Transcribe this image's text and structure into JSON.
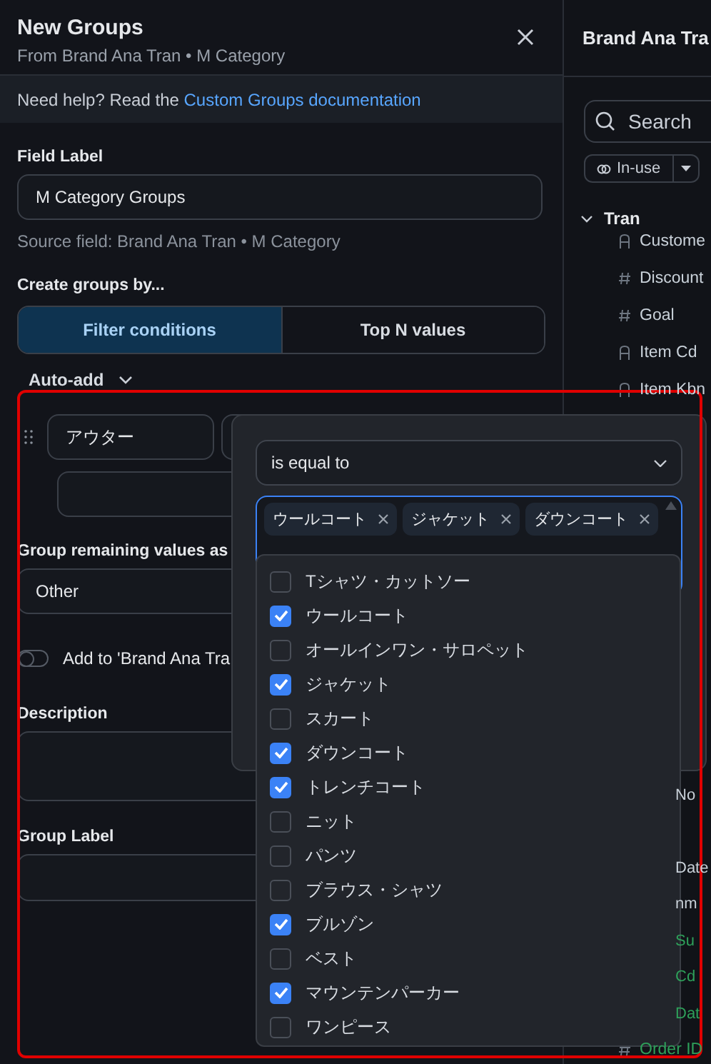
{
  "panel": {
    "title": "New Groups",
    "subtitle": "From Brand Ana Tran • M Category",
    "help": {
      "text": "Need help? Read the",
      "link": "Custom Groups documentation"
    },
    "field_label": {
      "label": "Field Label",
      "value": "M Category Groups",
      "hint": "Source field: Brand Ana Tran • M Category"
    },
    "create_groups_by": {
      "label": "Create groups by...",
      "options": [
        {
          "label": "Filter conditions",
          "selected": true
        },
        {
          "label": "Top N values",
          "selected": false
        }
      ]
    },
    "auto_add": {
      "label": "Auto-add"
    },
    "group": {
      "value": "アウター"
    },
    "remaining": {
      "label": "Group remaining values as",
      "value": "Other"
    },
    "add_toggle": {
      "label": "Add to 'Brand Ana Tra",
      "on": false
    },
    "description": {
      "label": "Description"
    },
    "group_label": {
      "label": "Group Label"
    }
  },
  "condition_popover": {
    "operator": "is equal to",
    "tags": [
      "ウールコート",
      "ジャケット",
      "ダウンコート"
    ],
    "options": [
      {
        "label": "Tシャツ・カットソー",
        "checked": false
      },
      {
        "label": "ウールコート",
        "checked": true
      },
      {
        "label": "オールインワン・サロペット",
        "checked": false
      },
      {
        "label": "ジャケット",
        "checked": true
      },
      {
        "label": "スカート",
        "checked": false
      },
      {
        "label": "ダウンコート",
        "checked": true
      },
      {
        "label": "トレンチコート",
        "checked": true
      },
      {
        "label": "ニット",
        "checked": false
      },
      {
        "label": "パンツ",
        "checked": false
      },
      {
        "label": "ブラウス・シャツ",
        "checked": false
      },
      {
        "label": "ブルゾン",
        "checked": true
      },
      {
        "label": "ベスト",
        "checked": false
      },
      {
        "label": "マウンテンパーカー",
        "checked": true
      },
      {
        "label": "ワンピース",
        "checked": false
      }
    ]
  },
  "right_panel": {
    "title": "Brand Ana Tra",
    "search": {
      "placeholder": "Search"
    },
    "filter": {
      "label": "In-use"
    },
    "tree": {
      "label": "Tran",
      "expanded": true,
      "children": [
        {
          "label": "Custome",
          "kind": "text",
          "color": "#c9d1d9"
        },
        {
          "label": "Discount",
          "kind": "number",
          "color": "#c9d1d9"
        },
        {
          "label": "Goal",
          "kind": "number",
          "color": "#c9d1d9"
        },
        {
          "label": "Item Cd",
          "kind": "text",
          "color": "#c9d1d9"
        },
        {
          "label": "Item Kbn",
          "kind": "text",
          "color": "#c9d1d9"
        }
      ]
    },
    "partial_rows": [
      {
        "label": "No",
        "color": "#c9d1d9"
      },
      {
        "label": "Date",
        "color": "#c9d1d9"
      },
      {
        "label": "nm",
        "color": "#c9d1d9"
      },
      {
        "label": "Su",
        "color": "#2ea05a"
      },
      {
        "label": "Cd",
        "color": "#2ea05a"
      },
      {
        "label": "Dat",
        "color": "#2ea05a"
      }
    ],
    "last_row": {
      "label": "Order ID",
      "kind": "number",
      "color": "#2ea05a"
    }
  }
}
